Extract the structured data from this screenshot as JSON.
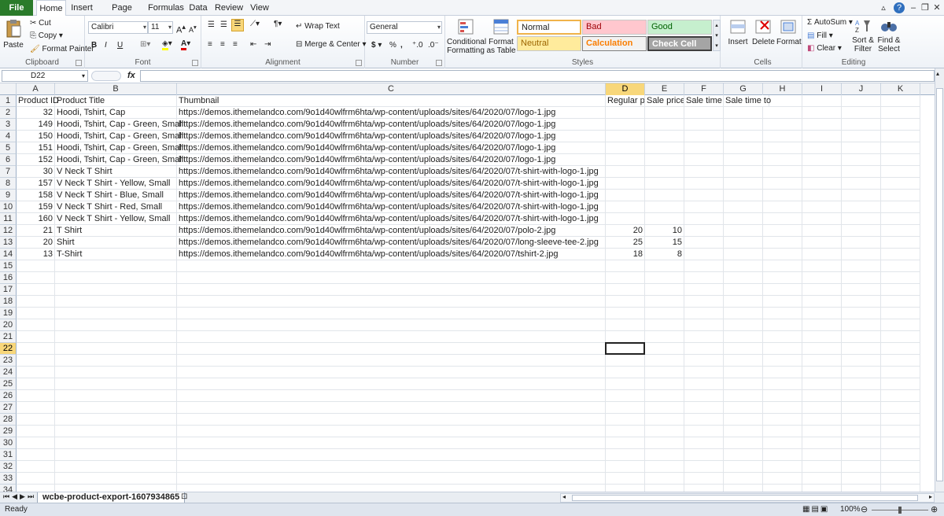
{
  "ribbon_tabs": [
    "File",
    "Home",
    "Insert",
    "Page Layout",
    "Formulas",
    "Data",
    "Review",
    "View"
  ],
  "clipboard": {
    "paste": "Paste",
    "cut": "Cut",
    "copy": "Copy",
    "format_painter": "Format Painter",
    "label": "Clipboard"
  },
  "font": {
    "name": "Calibri",
    "size": "11",
    "bold": "B",
    "italic": "I",
    "underline": "U",
    "grow": "A",
    "shrink": "A",
    "label": "Font"
  },
  "alignment": {
    "wrap_text": "Wrap Text",
    "merge_center": "Merge & Center",
    "label": "Alignment"
  },
  "number": {
    "format": "General",
    "currency": "$",
    "percent": "%",
    "label": "Number"
  },
  "styles": {
    "conditional": "Conditional Formatting",
    "format_table": "Format as Table",
    "normal": "Normal",
    "bad": "Bad",
    "good": "Good",
    "neutral": "Neutral",
    "calculation": "Calculation",
    "check_cell": "Check Cell",
    "label": "Styles"
  },
  "cells_group": {
    "insert": "Insert",
    "delete": "Delete",
    "format": "Format",
    "label": "Cells"
  },
  "editing": {
    "autosum": "AutoSum",
    "fill": "Fill",
    "clear": "Clear",
    "sort_filter": "Sort & Filter",
    "find_select": "Find & Select",
    "label": "Editing"
  },
  "formula_bar": {
    "name_box": "D22",
    "fx": "fx",
    "value": ""
  },
  "columns": [
    "A",
    "B",
    "C",
    "D",
    "E",
    "F",
    "G",
    "H",
    "I",
    "J",
    "K"
  ],
  "selected_column": "D",
  "selected_row": "22",
  "headers": [
    "Product ID",
    "Product Title",
    "Thumbnail",
    "Regular pr",
    "Sale price",
    "Sale time f",
    "Sale time to"
  ],
  "rows": [
    {
      "id": "32",
      "title": "Hoodi, Tshirt, Cap",
      "thumb": "https://demos.ithemelandco.com/9o1d40wlfrm6hta/wp-content/uploads/sites/64/2020/07/logo-1.jpg",
      "regular": "",
      "sale": ""
    },
    {
      "id": "149",
      "title": "Hoodi, Tshirt, Cap - Green, Small",
      "thumb": "https://demos.ithemelandco.com/9o1d40wlfrm6hta/wp-content/uploads/sites/64/2020/07/logo-1.jpg",
      "regular": "",
      "sale": ""
    },
    {
      "id": "150",
      "title": "Hoodi, Tshirt, Cap - Green, Small",
      "thumb": "https://demos.ithemelandco.com/9o1d40wlfrm6hta/wp-content/uploads/sites/64/2020/07/logo-1.jpg",
      "regular": "",
      "sale": ""
    },
    {
      "id": "151",
      "title": "Hoodi, Tshirt, Cap - Green, Small",
      "thumb": "https://demos.ithemelandco.com/9o1d40wlfrm6hta/wp-content/uploads/sites/64/2020/07/logo-1.jpg",
      "regular": "",
      "sale": ""
    },
    {
      "id": "152",
      "title": "Hoodi, Tshirt, Cap - Green, Small",
      "thumb": "https://demos.ithemelandco.com/9o1d40wlfrm6hta/wp-content/uploads/sites/64/2020/07/logo-1.jpg",
      "regular": "",
      "sale": ""
    },
    {
      "id": "30",
      "title": "V Neck T Shirt",
      "thumb": "https://demos.ithemelandco.com/9o1d40wlfrm6hta/wp-content/uploads/sites/64/2020/07/t-shirt-with-logo-1.jpg",
      "regular": "",
      "sale": ""
    },
    {
      "id": "157",
      "title": "V Neck T Shirt - Yellow, Small",
      "thumb": "https://demos.ithemelandco.com/9o1d40wlfrm6hta/wp-content/uploads/sites/64/2020/07/t-shirt-with-logo-1.jpg",
      "regular": "",
      "sale": ""
    },
    {
      "id": "158",
      "title": "V Neck T Shirt - Blue, Small",
      "thumb": "https://demos.ithemelandco.com/9o1d40wlfrm6hta/wp-content/uploads/sites/64/2020/07/t-shirt-with-logo-1.jpg",
      "regular": "",
      "sale": ""
    },
    {
      "id": "159",
      "title": "V Neck T Shirt - Red, Small",
      "thumb": "https://demos.ithemelandco.com/9o1d40wlfrm6hta/wp-content/uploads/sites/64/2020/07/t-shirt-with-logo-1.jpg",
      "regular": "",
      "sale": ""
    },
    {
      "id": "160",
      "title": "V Neck T Shirt - Yellow, Small",
      "thumb": "https://demos.ithemelandco.com/9o1d40wlfrm6hta/wp-content/uploads/sites/64/2020/07/t-shirt-with-logo-1.jpg",
      "regular": "",
      "sale": ""
    },
    {
      "id": "21",
      "title": "T Shirt",
      "thumb": "https://demos.ithemelandco.com/9o1d40wlfrm6hta/wp-content/uploads/sites/64/2020/07/polo-2.jpg",
      "regular": "20",
      "sale": "10"
    },
    {
      "id": "20",
      "title": "Shirt",
      "thumb": "https://demos.ithemelandco.com/9o1d40wlfrm6hta/wp-content/uploads/sites/64/2020/07/long-sleeve-tee-2.jpg",
      "regular": "25",
      "sale": "15"
    },
    {
      "id": "13",
      "title": "T-Shirt",
      "thumb": "https://demos.ithemelandco.com/9o1d40wlfrm6hta/wp-content/uploads/sites/64/2020/07/tshirt-2.jpg",
      "regular": "18",
      "sale": "8"
    }
  ],
  "row_count": 34,
  "sheet": {
    "name": "wcbe-product-export-1607934865"
  },
  "status": {
    "ready": "Ready",
    "zoom": "100%"
  },
  "colors": {
    "file_tab": "#2a7b2a",
    "selected_header": "#f8d77a",
    "bad_bg": "#ffc7ce",
    "good_bg": "#c6efce",
    "neutral_bg": "#ffeb9c",
    "check_cell_bg": "#a5a5a5"
  }
}
